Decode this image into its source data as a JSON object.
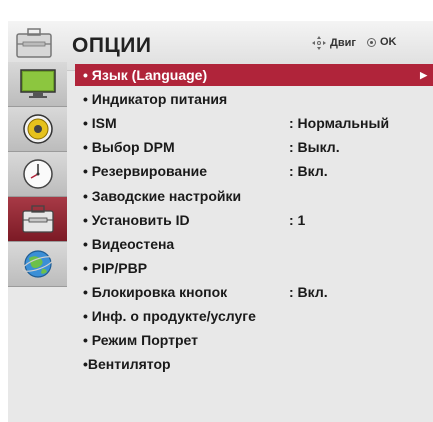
{
  "header": {
    "title": "ОПЦИИ",
    "nav_hint": "Двиг",
    "ok_hint": "OK"
  },
  "menu": {
    "items": [
      {
        "label": "• Язык (Language)",
        "value": "",
        "selected": true
      },
      {
        "label": "• Индикатор питания",
        "value": ""
      },
      {
        "label": "• ISM",
        "value": ": Нормальный"
      },
      {
        "label": "• Выбор DPM",
        "value": ": Выкл."
      },
      {
        "label": "• Резервирование",
        "value": ": Вкл."
      },
      {
        "label": "• Заводские настройки",
        "value": ""
      },
      {
        "label": "• Установить ID",
        "value": ": 1"
      },
      {
        "label": "• Видеостена",
        "value": ""
      },
      {
        "label": "• PIP/PBP",
        "value": ""
      },
      {
        "label": "• Блокировка кнопок",
        "value": ": Вкл."
      },
      {
        "label": "• Инф. о продукте/услуге",
        "value": ""
      },
      {
        "label": "• Режим Портрет",
        "value": ""
      },
      {
        "label": "•Вентилятор",
        "value": ""
      }
    ]
  },
  "tabs": [
    {
      "icon": "picture-icon"
    },
    {
      "icon": "sound-icon"
    },
    {
      "icon": "clock-icon"
    },
    {
      "icon": "toolbox-icon",
      "active": true
    },
    {
      "icon": "network-globe-icon"
    }
  ],
  "colors": {
    "accent": "#b0243a",
    "panel": "#e8e8e8",
    "tab": "#c8c8c8"
  }
}
